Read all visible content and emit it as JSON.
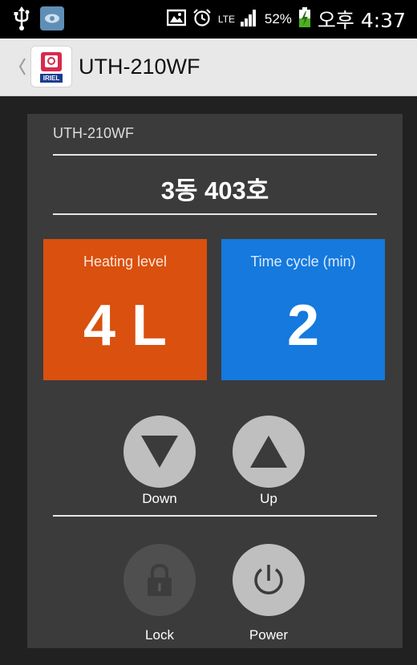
{
  "status_bar": {
    "icons": [
      "usb-icon",
      "notification-image-icon",
      "picture-icon",
      "alarm-icon",
      "lte-icon",
      "signal-icon",
      "battery-charging-icon"
    ],
    "lte": "LTE",
    "battery": "52%",
    "time": "오후 4:37"
  },
  "action_bar": {
    "app_icon_badge": "IRIEL",
    "title": "UTH-210WF"
  },
  "device": {
    "name": "UTH-210WF",
    "room": "3동 403호"
  },
  "tiles": {
    "heating_label": "Heating level",
    "heating_value": "4 L",
    "time_label": "Time cycle (min)",
    "time_value": "2"
  },
  "controls": {
    "down_label": "Down",
    "up_label": "Up",
    "lock_label": "Lock",
    "power_label": "Power"
  },
  "colors": {
    "background": "#212121",
    "panel": "#3b3b3b",
    "heating_tile": "#d9500f",
    "time_tile": "#1579de",
    "button": "#bfbfbf",
    "button_disabled": "#4f4f4f"
  }
}
